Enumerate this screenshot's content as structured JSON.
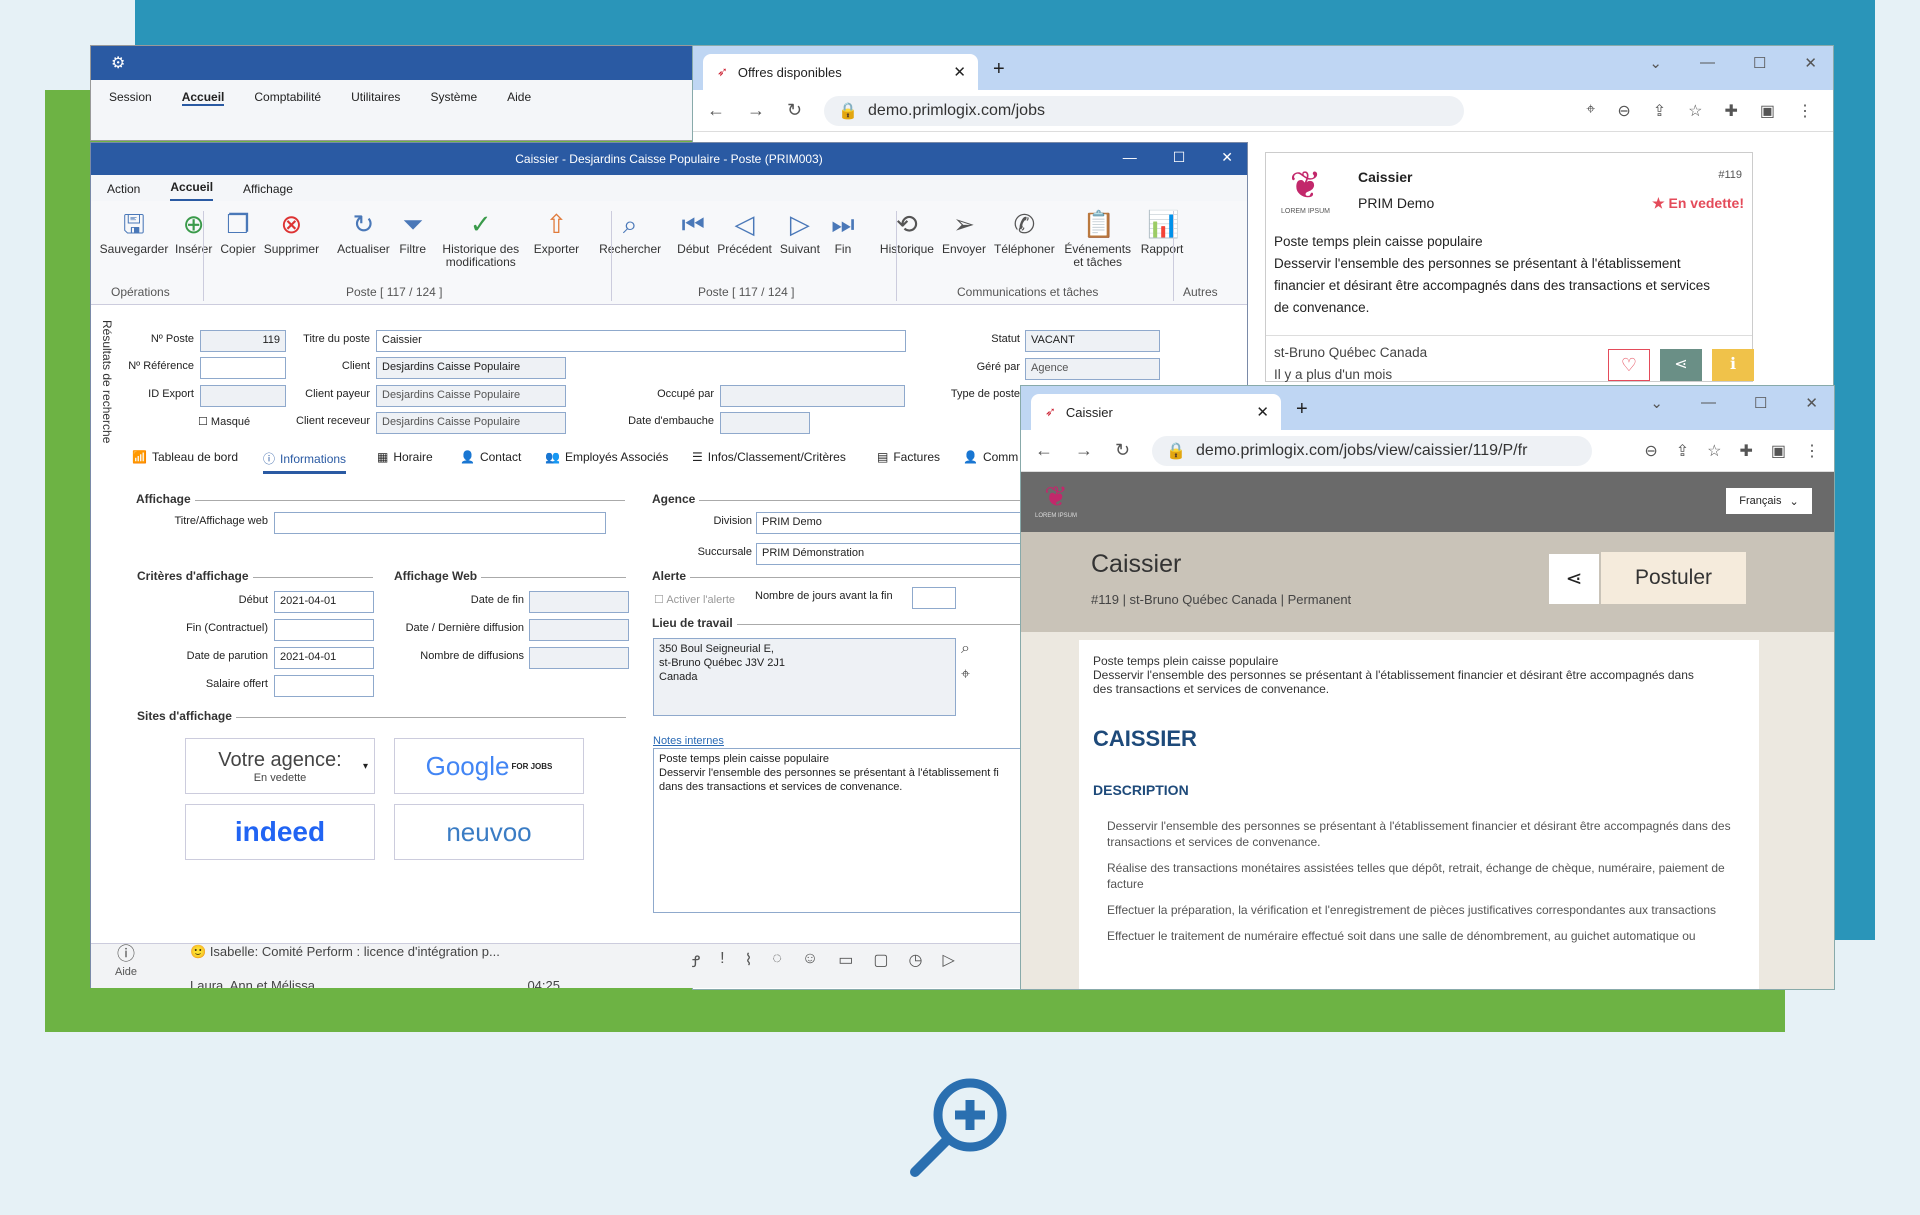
{
  "colors": {
    "accent": "#2a5aa3",
    "bg_blue": "#2a95b9",
    "bg_green": "#6db344",
    "featured": "#e44b5a"
  },
  "back_app": {
    "menu": [
      "Session",
      "Accueil",
      "Comptabilité",
      "Utilitaires",
      "Système",
      "Aide"
    ]
  },
  "main_window": {
    "title": "Caissier - Desjardins Caisse Populaire - Poste (PRIM003)",
    "tabs": [
      "Action",
      "Accueil",
      "Affichage"
    ],
    "ribbon": [
      {
        "label": "Sauvegarder",
        "icon": "save-icon"
      },
      {
        "label": "Insérer",
        "icon": "add-icon"
      },
      {
        "label": "Copier",
        "icon": "copy-icon"
      },
      {
        "label": "Supprimer",
        "icon": "delete-icon"
      },
      {
        "label": "Actualiser",
        "icon": "refresh-icon"
      },
      {
        "label": "Filtre",
        "icon": "filter-icon"
      },
      {
        "label": "Historique des modifications",
        "icon": "history-icon"
      },
      {
        "label": "Exporter",
        "icon": "export-icon"
      },
      {
        "label": "Rechercher",
        "icon": "search-icon"
      },
      {
        "label": "Début",
        "icon": "first-icon"
      },
      {
        "label": "Précédent",
        "icon": "previous-icon"
      },
      {
        "label": "Suivant",
        "icon": "next-icon"
      },
      {
        "label": "Fin",
        "icon": "last-icon"
      },
      {
        "label": "Historique",
        "icon": "history-icon"
      },
      {
        "label": "Envoyer",
        "icon": "send-icon"
      },
      {
        "label": "Téléphoner",
        "icon": "phone-icon"
      },
      {
        "label": "Événements et tâches",
        "icon": "events-icon"
      },
      {
        "label": "Rapport",
        "icon": "report-icon"
      }
    ],
    "groups": {
      "ops": "Opérations",
      "pos1": "Poste [ 117 / 124 ]",
      "pos2": "Poste [ 117 / 124 ]",
      "comm": "Communications et tâches",
      "others": "Autres"
    },
    "side_label": "Résultats de recherche",
    "fields": {
      "no_poste_l": "Nº Poste",
      "no_poste": "119",
      "titre_l": "Titre du poste",
      "titre": "Caissier",
      "statut_l": "Statut",
      "statut": "VACANT",
      "ref_l": "Nº Référence",
      "client_l": "Client",
      "client": "Desjardins Caisse Populaire",
      "gere_l": "Géré par",
      "gere": "Agence",
      "idexport_l": "ID Export",
      "payeur_l": "Client payeur",
      "payeur": "Desjardins Caisse Populaire",
      "occupe_l": "Occupé par",
      "type_l": "Type de poste",
      "masque_l": "Masqué",
      "receveur_l": "Client receveur",
      "receveur": "Desjardins Caisse Populaire",
      "embauche_l": "Date d'embauche"
    },
    "info_tabs": [
      "Tableau de bord",
      "Informations",
      "Horaire",
      "Contact",
      "Employés Associés",
      "Infos/Classement/Critères",
      "Factures",
      "Comm"
    ],
    "affichage": {
      "title": "Affichage",
      "titre_web_l": "Titre/Affichage web",
      "criteres": "Critères d'affichage",
      "web": "Affichage Web",
      "debut_l": "Début",
      "debut": "2021-04-01",
      "fin_l": "Fin (Contractuel)",
      "parution_l": "Date de parution",
      "parution": "2021-04-01",
      "salaire_l": "Salaire offert",
      "datefin_l": "Date de fin",
      "derniere_l": "Date / Dernière diffusion",
      "nb_l": "Nombre de diffusions",
      "sites": "Sites d'affichage",
      "agence_title": "Votre agence:",
      "agence_sub": "En vedette",
      "google": "Google",
      "google_sub": "FOR JOBS",
      "indeed": "indeed",
      "neuvoo": "neuvoo"
    },
    "agence": {
      "title": "Agence",
      "division_l": "Division",
      "division": "PRIM Demo",
      "succ_l": "Succursale",
      "succ": "PRIM Démonstration",
      "alerte": "Alerte",
      "activer": "Activer l'alerte",
      "nbjours": "Nombre de jours avant la fin",
      "lieu": "Lieu de travail",
      "addr1": "350 Boul Seigneurial E,",
      "addr2": "st-Bruno Québec J3V 2J1",
      "addr3": "Canada",
      "notes_l": "Notes internes",
      "note1": "Poste temps plein caisse populaire",
      "note2": "Desservir l'ensemble des personnes se présentant à l'établissement fi",
      "note3": "dans des transactions et services de convenance."
    },
    "footer": {
      "aide": "Aide",
      "msg1": "Isabelle: Comité Perform : licence d'intégration p...",
      "msg2": "Laura, Ann et Mélissa",
      "time": "04:25"
    }
  },
  "browser1": {
    "tab": "Offres disponibles",
    "url": "demo.primlogix.com/jobs",
    "card": {
      "title": "Caissier",
      "num": "#119",
      "company": "PRIM Demo",
      "featured": "En vedette!",
      "logo_text": "LOREM IPSUM",
      "desc1": "Poste temps plein caisse populaire",
      "desc2": "Desservir l'ensemble des personnes se présentant à l'établissement",
      "desc3": "financier et désirant être accompagnés dans des transactions et services",
      "desc4": "de convenance.",
      "loc": "st-Bruno Québec Canada",
      "age": "Il y a plus d'un mois"
    }
  },
  "browser2": {
    "tab": "Caissier",
    "url": "demo.primlogix.com/jobs/view/caissier/119/P/fr",
    "lang": "Français",
    "logo_text": "LOREM IPSUM",
    "title": "Caissier",
    "sub": "#119 | st-Bruno Québec Canada | Permanent",
    "apply": "Postuler",
    "intro1": "Poste temps plein caisse populaire",
    "intro2": "Desservir l'ensemble des personnes se présentant à l'établissement financier et désirant être accompagnés dans",
    "intro3": "des transactions et services de convenance.",
    "h1": "CAISSIER",
    "h2": "DESCRIPTION",
    "bullets": [
      "Desservir l'ensemble des personnes se présentant à l'établissement financier et désirant être accompagnés dans des transactions et services de convenance.",
      "Réalise des transactions monétaires assistées telles que dépôt, retrait, échange de chèque, numéraire, paiement de facture",
      "Effectuer la préparation, la vérification et l'enregistrement de pièces justificatives correspondantes aux transactions",
      "Effectuer le traitement de numéraire effectué soit dans une salle de dénombrement, au guichet automatique ou"
    ]
  }
}
